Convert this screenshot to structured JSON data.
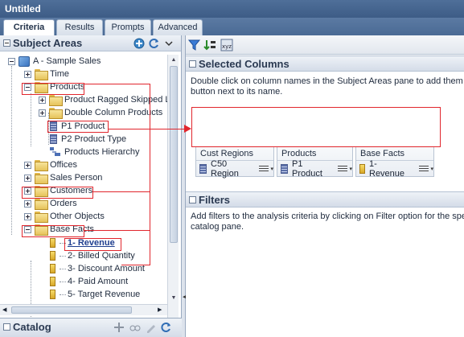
{
  "window": {
    "title": "Untitled"
  },
  "tabs": [
    {
      "label": "Criteria",
      "active": true
    },
    {
      "label": "Results",
      "active": false
    },
    {
      "label": "Prompts",
      "active": false
    },
    {
      "label": "Advanced",
      "active": false
    }
  ],
  "subject_areas": {
    "title": "Subject Areas",
    "tree": {
      "root": "A - Sample Sales",
      "time": "Time",
      "products": "Products",
      "product_ragged": "Product Ragged Skipped L",
      "double_column": "Double Column Products",
      "p1_product": "P1 Product",
      "p2_product_type": "P2 Product Type",
      "products_hierarchy": "Products Hierarchy",
      "offices": "Offices",
      "sales_person": "Sales Person",
      "customers": "Customers",
      "orders": "Orders",
      "other_objects": "Other Objects",
      "base_facts": "Base Facts",
      "revenue": "1- Revenue",
      "billed_quantity": "2- Billed Quantity",
      "discount_amount": "3- Discount Amount",
      "paid_amount": "4- Paid Amount",
      "target_revenue": "5- Target Revenue"
    }
  },
  "catalog": {
    "title": "Catalog"
  },
  "selected_columns": {
    "title": "Selected Columns",
    "help_line1": "Double click on column names in the Subject Areas pane to add them to",
    "help_line2": "button next to its name.",
    "columns": [
      {
        "folder": "Cust Regions",
        "column": "C50 Region"
      },
      {
        "folder": "Products",
        "column": "P1 Product"
      },
      {
        "folder": "Base Facts",
        "column": "1- Revenue"
      }
    ]
  },
  "filters": {
    "title": "Filters",
    "help_line1": "Add filters to the analysis criteria by clicking on Filter option for the spe",
    "help_line2": "catalog pane."
  },
  "colors": {
    "highlight": "#e1262d",
    "header_blue": "#4a6a94"
  }
}
